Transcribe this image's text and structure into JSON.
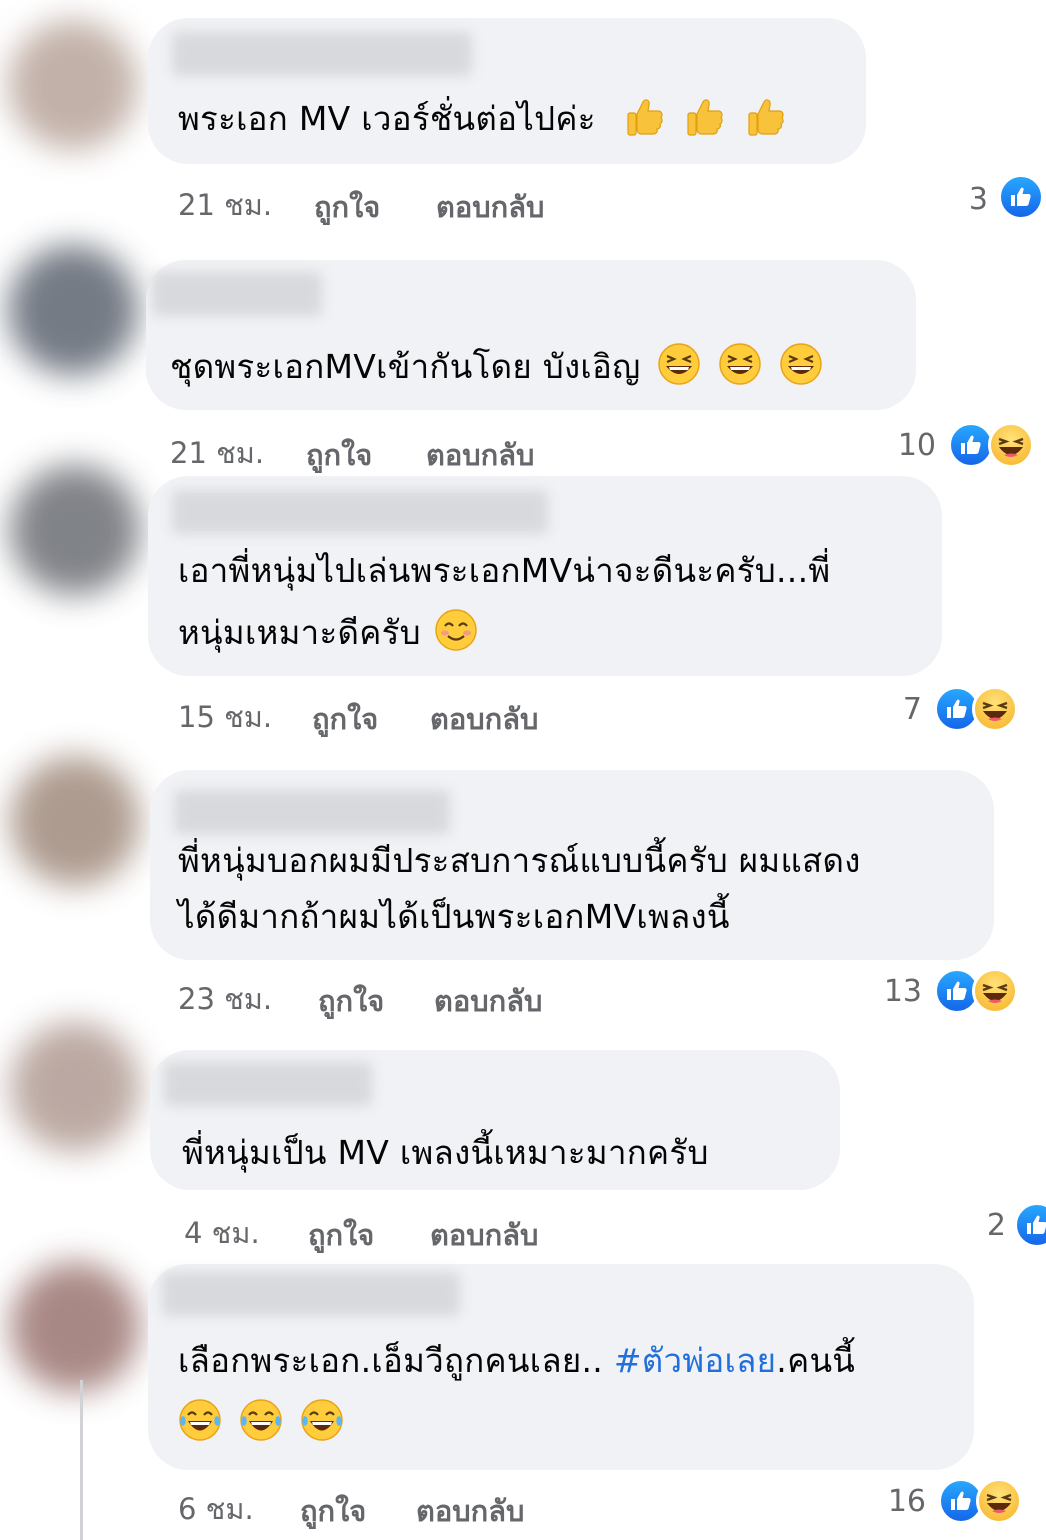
{
  "actions": {
    "like": "ถูกใจ",
    "reply": "ตอบกลับ"
  },
  "colors": {
    "bubble": "#f0f2f5",
    "meta_text": "#65676b",
    "hashtag": "#216fdb",
    "like_blue": "#1877f2",
    "haha_yellow": "#f7b125"
  },
  "comments": [
    {
      "text": "พระเอก MV เวอร์ชั่นต่อไปค่ะ",
      "emojis": [
        "thumbs-up",
        "thumbs-up",
        "thumbs-up"
      ],
      "time": "21 ชม.",
      "reaction_count": "3",
      "reactions": [
        "like-icon"
      ]
    },
    {
      "text": "ชุดพระเอกMVเข้ากันโดย บังเอิญ",
      "emojis": [
        "grinning-squint",
        "grinning-squint",
        "grinning-squint"
      ],
      "time": "21 ชม.",
      "reaction_count": "10",
      "reactions": [
        "like-icon",
        "haha-icon"
      ]
    },
    {
      "lines": [
        "เอาพี่หนุ่มไปเล่นพระเอกMVน่าจะดีนะครับ...พี่",
        "หนุ่มเหมาะดีครับ"
      ],
      "emojis": [
        "smiling-eyes"
      ],
      "time": "15 ชม.",
      "reaction_count": "7",
      "reactions": [
        "like-icon",
        "haha-icon"
      ]
    },
    {
      "lines": [
        "พี่หนุ่มบอกผมมีประสบการณ์แบบนี้ครับ ผมแสดง",
        "ได้ดีมากถ้าผมได้เป็นพระเอกMVเพลงนี้"
      ],
      "time": "23 ชม.",
      "reaction_count": "13",
      "reactions": [
        "like-icon",
        "haha-icon"
      ]
    },
    {
      "text": "พี่หนุ่มเป็น MV เพลงนี้เหมาะมากครับ",
      "time": "4 ชม.",
      "reaction_count": "2",
      "reactions": [
        "like-icon"
      ]
    },
    {
      "text_before": "เลือกพระเอก.เอ็มวีถูกคนเลย.. ",
      "hashtag": "#ตัวพ่อเลย",
      "text_after": ".คนนี้",
      "emojis": [
        "tears-of-joy",
        "tears-of-joy",
        "tears-of-joy"
      ],
      "time": "6 ชม.",
      "reaction_count": "16",
      "reactions": [
        "like-icon",
        "haha-icon"
      ]
    }
  ]
}
